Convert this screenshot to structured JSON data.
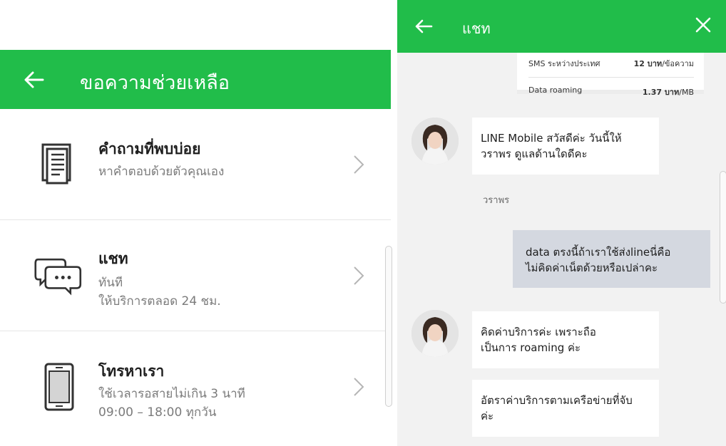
{
  "help": {
    "header_title": "ขอความช่วยเหลือ",
    "items": [
      {
        "title": "คำถามที่พบบ่อย",
        "lines": [
          "หาคำตอบด้วยตัวคุณเอง"
        ],
        "icon": "document-icon"
      },
      {
        "title": "แชท",
        "lines": [
          "ทันที",
          "ให้บริการตลอด 24 ชม."
        ],
        "icon": "chat-bubbles-icon"
      },
      {
        "title": "โทรหาเรา",
        "lines": [
          "ใช้เวลารอสายไม่เกิน 3 นาที",
          "09:00 – 18:00 ทุกวัน"
        ],
        "icon": "phone-icon"
      }
    ]
  },
  "chat": {
    "header_title": "แชท",
    "rates": [
      {
        "label": "SMS ระหว่างประเทศ",
        "value_bold": "12 บาท",
        "value_unit": "/ข้อความ"
      },
      {
        "label": "Data roaming",
        "value_bold": "1.37 บาท",
        "value_unit": "/MB"
      }
    ],
    "agent_name": "วราพร",
    "messages": [
      {
        "from": "agent",
        "text": "LINE Mobile สวัสดีค่ะ วันนี้ให้\nวราพร ดูแลด้านใดดีคะ"
      },
      {
        "from": "user",
        "text": "data ตรงนี้ถ้าเราใช้ส่งlineนี่คือ\nไม่คิดค่าเน็ตด้วยหรือเปล่าคะ"
      },
      {
        "from": "agent",
        "text": "คิดค่าบริการค่ะ เพราะถือ\nเป็นการ roaming ค่ะ"
      },
      {
        "from": "agent",
        "text": "อัตราค่าบริการตามเครือข่ายที่จับ\nค่ะ"
      }
    ]
  },
  "colors": {
    "brand_green": "#21bd4a",
    "user_bubble": "#d4d8e0"
  }
}
